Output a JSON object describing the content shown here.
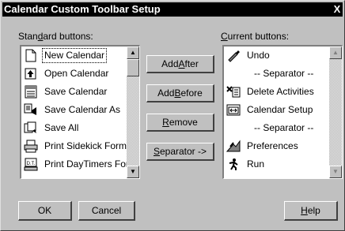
{
  "dialog": {
    "title": "Calendar Custom Toolbar Setup",
    "close_glyph": "X"
  },
  "standard": {
    "label_pre": "Stan",
    "label_key": "d",
    "label_post": "ard buttons:",
    "items": [
      {
        "label": "New Calendar",
        "icon": "new-document-icon",
        "selected": true
      },
      {
        "label": "Open Calendar",
        "icon": "open-arrow-icon"
      },
      {
        "label": "Save Calendar",
        "icon": "calendar-save-icon"
      },
      {
        "label": "Save Calendar As",
        "icon": "save-as-icon"
      },
      {
        "label": "Save All",
        "icon": "save-all-icon"
      },
      {
        "label": "Print Sidekick Forma",
        "icon": "printer-icon"
      },
      {
        "label": "Print DayTimers For",
        "icon": "daytimer-print-icon"
      }
    ],
    "scroll_up": "▲",
    "scroll_down": "▼"
  },
  "current": {
    "label_pre": "",
    "label_key": "C",
    "label_post": "urrent buttons:",
    "items": [
      {
        "label": "Undo",
        "icon": "undo-brush-icon"
      },
      {
        "label": "-- Separator --",
        "separator": true
      },
      {
        "label": "Delete Activities",
        "icon": "delete-activities-icon"
      },
      {
        "label": "Calendar Setup",
        "icon": "calendar-setup-icon"
      },
      {
        "label": "-- Separator --",
        "separator": true
      },
      {
        "label": "Preferences",
        "icon": "preferences-icon"
      },
      {
        "label": "Run",
        "icon": "run-icon"
      }
    ],
    "scroll_up": "▲",
    "scroll_down": "▼"
  },
  "actions": {
    "add_after_pre": "Add ",
    "add_after_key": "A",
    "add_after_post": "fter",
    "add_before_pre": "Add ",
    "add_before_key": "B",
    "add_before_post": "efore",
    "remove_pre": "",
    "remove_key": "R",
    "remove_post": "emove",
    "separator_pre": "",
    "separator_key": "S",
    "separator_post": "eparator ->"
  },
  "footer": {
    "ok": "OK",
    "cancel": "Cancel",
    "help_key": "H",
    "help_post": "elp"
  }
}
